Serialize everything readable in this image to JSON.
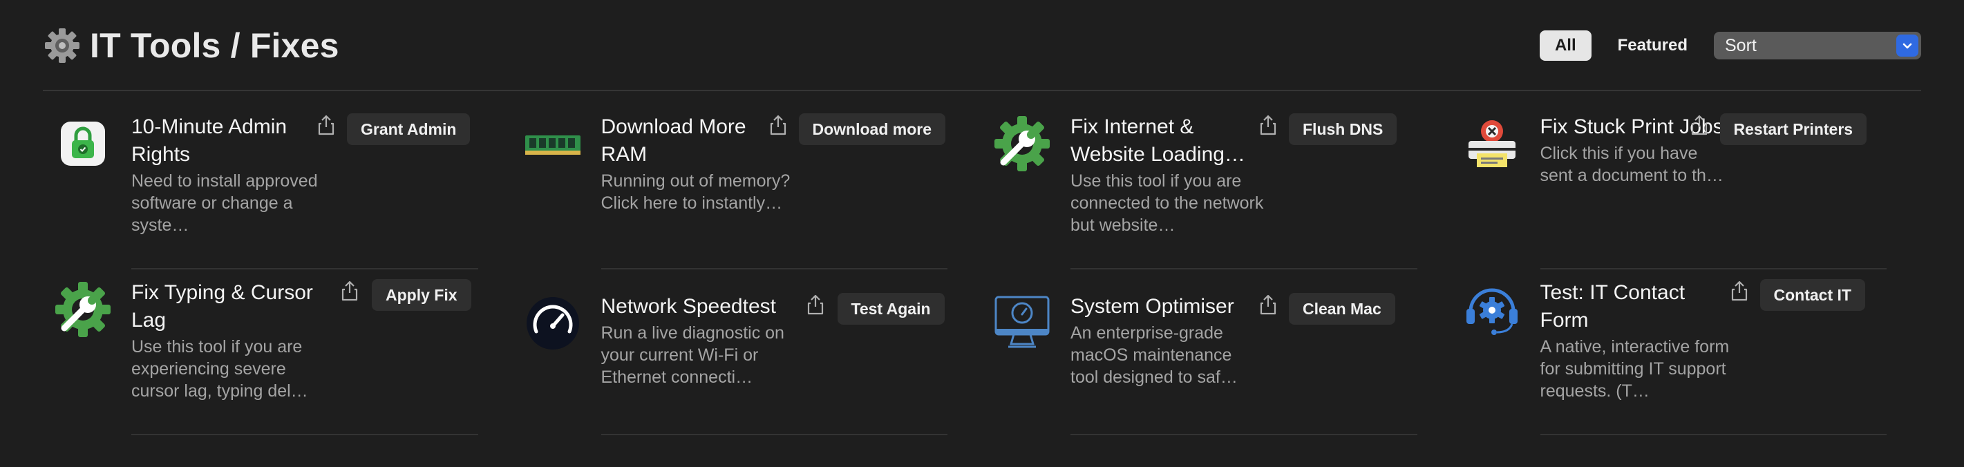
{
  "header": {
    "title": "IT Tools / Fixes",
    "filters": {
      "all": "All",
      "featured": "Featured"
    },
    "sort_label": "Sort"
  },
  "tools": [
    {
      "name": "10-Minute Admin Rights",
      "desc": "Need to install approved software or change a syste…",
      "action": "Grant Admin"
    },
    {
      "name": "Download More RAM",
      "desc": "Running out of memory? Click here to instantly…",
      "action": "Download more"
    },
    {
      "name": "Fix Internet & Website Loading…",
      "desc": "Use this tool if you are connected to the network but website…",
      "action": "Flush DNS"
    },
    {
      "name": "Fix Stuck Print Jobs",
      "desc": "Click this if you have sent a document to th…",
      "action": "Restart Printers"
    },
    {
      "name": "Fix Typing & Cursor Lag",
      "desc": "Use this tool if you are experiencing severe cursor lag, typing del…",
      "action": "Apply Fix"
    },
    {
      "name": "Network Speedtest",
      "desc": "Run a live diagnostic on your current Wi-Fi or Ethernet connecti…",
      "action": "Test Again"
    },
    {
      "name": "System Optimiser",
      "desc": "An enterprise-grade macOS maintenance tool designed to saf…",
      "action": "Clean Mac"
    },
    {
      "name": "Test: IT Contact Form",
      "desc": "A native, interactive form for submitting IT support requests. (T…",
      "action": "Contact IT"
    }
  ],
  "colors": {
    "background": "#1e1e1e",
    "accent_blue": "#2f6ae2",
    "gear_green": "#4aa34a",
    "lock_green": "#3cb54a"
  },
  "icons": [
    "gear-icon",
    "lock-icon",
    "ram-icon",
    "wrench-gear-icon",
    "printer-icon",
    "speedometer-icon",
    "monitor-gauge-icon",
    "headset-gear-icon",
    "share-icon",
    "chevron-down-icon"
  ]
}
